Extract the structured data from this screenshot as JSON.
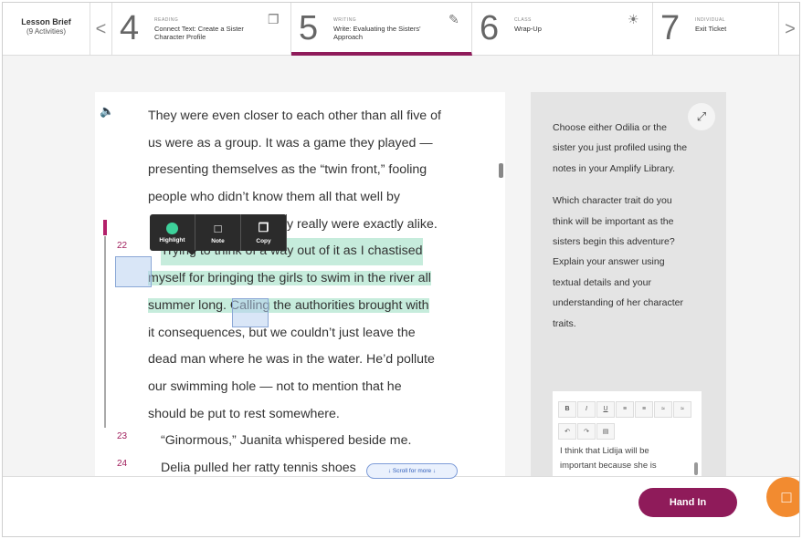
{
  "lesson_brief": {
    "title": "Lesson Brief",
    "subtitle": "(9 Activities)"
  },
  "nav": {
    "prev_icon": "chevron-left-icon",
    "next_icon": "chevron-right-icon",
    "prev_glyph": "<",
    "next_glyph": ">"
  },
  "activities": [
    {
      "number": "4",
      "kind": "READING",
      "title": "Connect Text: Create a Sister Character Profile",
      "icon": "document-icon",
      "glyph": "❐"
    },
    {
      "number": "5",
      "kind": "WRITING",
      "title": "Write: Evaluating the Sisters' Approach",
      "icon": "pencil-icon",
      "glyph": "✎",
      "active": true
    },
    {
      "number": "6",
      "kind": "CLASS",
      "title": "Wrap-Up",
      "icon": "lightbulb-icon",
      "glyph": "☀"
    },
    {
      "number": "7",
      "kind": "INDIVIDUAL",
      "title": "Exit Ticket",
      "icon": "",
      "glyph": ""
    }
  ],
  "reader": {
    "speaker_icon": "speaker-icon",
    "lines": [
      "They were even closer to each other than all five of",
      "us were as a group. It was a game they played —",
      "presenting themselves as the “twin front,” fooling",
      "people who didn’t know them all that well by",
      "",
      "Trying to think of a way out of it as I chastised",
      "myself for bringing the girls to swim in the river all",
      "summer long. Calling the authorities brought with",
      "it consequences, but we couldn’t just leave the",
      "dead man where he was in the water. He’d pollute",
      "our swimming hole — not to mention that he",
      "should be put to rest somewhere.",
      "“Ginormous,” Juanita whispered beside me.",
      "Delia pulled her ratty tennis shoes"
    ],
    "line4_tail": "y really were exactly alike.",
    "line_numbers": [
      "22",
      "23",
      "24"
    ],
    "scroll_more": "↓ Scroll for more ↓"
  },
  "toolbar": {
    "highlight": "Highlight",
    "note": "Note",
    "copy": "Copy"
  },
  "prompt": {
    "p1": "Choose either Odilia or the sister you just profiled using the notes in your Amplify Library.",
    "p2": "Which character trait do you think will be important as the sisters begin this adventure? Explain your answer using textual details and your understanding of her character traits.",
    "expand_icon": "expand-icon",
    "editor_buttons": [
      "B",
      "I",
      "U",
      "≡",
      "≡",
      "≈",
      "≈",
      "↶",
      "↷",
      "▤"
    ],
    "answer": "I think that Lidija will be important because she is"
  },
  "footer": {
    "hand_in": "Hand In",
    "chat_icon": "chat-icon"
  },
  "colors": {
    "accent": "#8f1b5a",
    "highlight": "#c6ecdc",
    "chat": "#f28b30"
  }
}
